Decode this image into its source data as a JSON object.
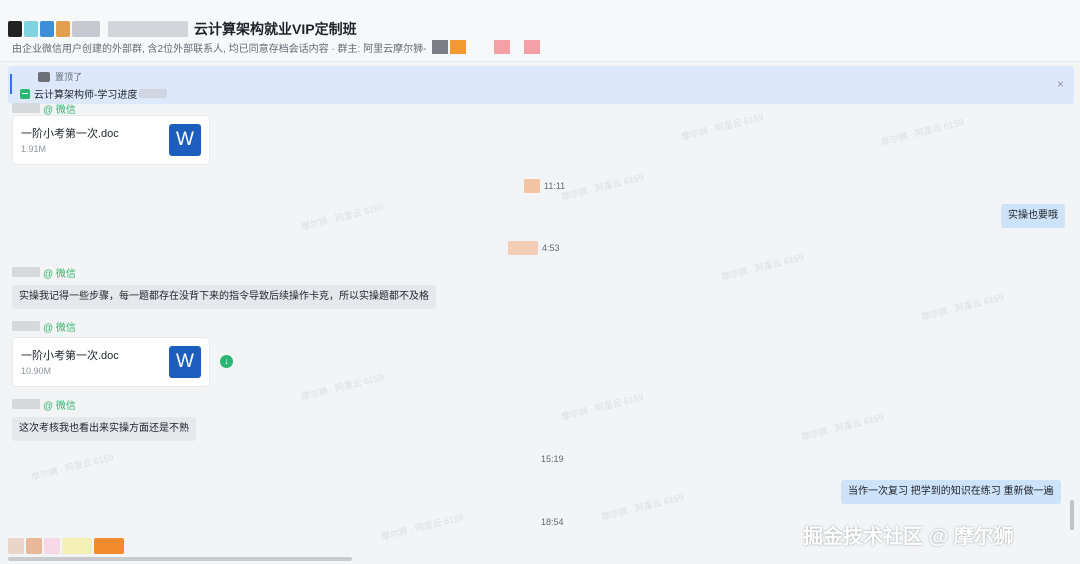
{
  "header": {
    "title": "云计算架构就业VIP定制班",
    "subtitle": "由企业微信用户创建的外部群, 含2位外部联系人, 均已同意存档会话内容 · 群主: 阿里云摩尔狮-",
    "title_chip_colors": [
      "#222222",
      "#7fd3e0",
      "#3f8fd8",
      "#e0a050",
      "#b8bcc4",
      "#cfd2d8",
      "#c6c9cf",
      "#d3d5da"
    ],
    "subtitle_chip_colors": [
      "#7c7f86",
      "#f29a2e",
      "#f4a0a6",
      "#f4a0a6"
    ]
  },
  "pinned": {
    "note": "置顶了",
    "doc_title": "云计算架构师-学习进度",
    "close_label": "×"
  },
  "messages": {
    "m1": {
      "sender_tag": "@ 微信",
      "file_name": "一阶小考第一次.doc",
      "file_size": "1.91M",
      "icon_letter": "W"
    },
    "t1": {
      "time": "11:11",
      "chip": "#f2c4a4"
    },
    "r1": {
      "text": "实操也要哦"
    },
    "t2": {
      "time": "4:53",
      "chip": "#f3cdb8"
    },
    "m2": {
      "sender_tag": "@ 微信",
      "text": "实操我记得一些步骤，每一题都存在没背下来的指令导致后续操作卡克，所以实操题都不及格"
    },
    "m3": {
      "sender_tag": "@ 微信",
      "file_name": "一阶小考第一次.doc",
      "file_size": "10.90M",
      "icon_letter": "W",
      "download_glyph": "↓"
    },
    "m4": {
      "sender_tag": "@ 微信",
      "text": "这次考核我也看出来实操方面还是不熟"
    },
    "t3": {
      "time": "15:19"
    },
    "r2": {
      "text": "当作一次复习 把学到的知识在练习 重新做一遍"
    },
    "t4": {
      "time": "18:54"
    }
  },
  "bottom_chip_colors": [
    "#e9d6c8",
    "#e8b898",
    "#f7d9e6",
    "#f5f0b6",
    "#f28a2e"
  ],
  "watermark": "掘金技术社区 @ 摩尔狮"
}
